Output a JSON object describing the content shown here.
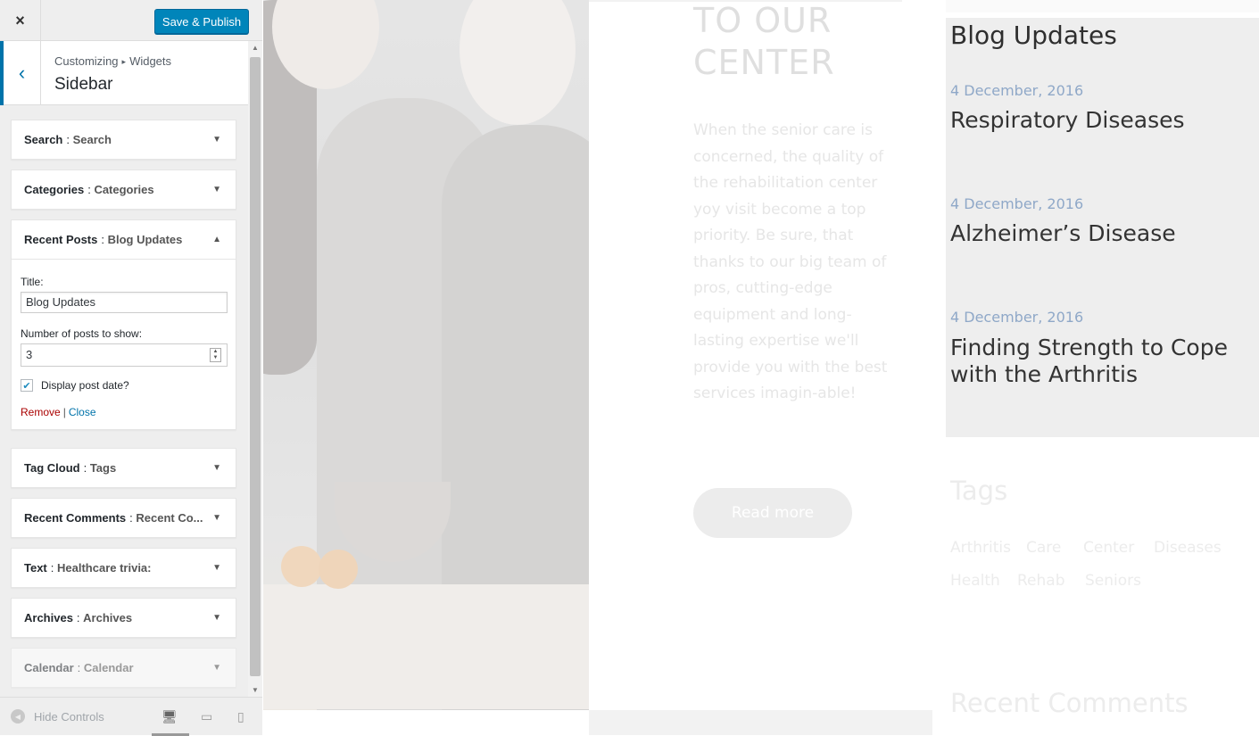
{
  "customizer": {
    "close_icon": "×",
    "save_label": "Save & Publish",
    "back_icon": "‹",
    "breadcrumb": {
      "root": "Customizing",
      "separator": "▸",
      "parent": "Widgets"
    },
    "section_title": "Sidebar",
    "widgets": [
      {
        "type": "Search",
        "instance": "Search",
        "toggle": "▼"
      },
      {
        "type": "Categories",
        "instance": "Categories",
        "toggle": "▼"
      },
      {
        "type": "Recent Posts",
        "instance": "Blog Updates",
        "toggle": "▲",
        "form": {
          "title_label": "Title:",
          "title_value": "Blog Updates",
          "number_label": "Number of posts to show:",
          "number_value": "3",
          "display_date_label": "Display post date?",
          "display_date_checked": true,
          "remove_label": "Remove",
          "separator": "|",
          "close_label": "Close"
        }
      },
      {
        "type": "Tag Cloud",
        "instance": "Tags",
        "toggle": "▼"
      },
      {
        "type": "Recent Comments",
        "instance": "Recent Co...",
        "toggle": "▼"
      },
      {
        "type": "Text",
        "instance": "Healthcare trivia:",
        "toggle": "▼"
      },
      {
        "type": "Archives",
        "instance": "Archives",
        "toggle": "▼"
      },
      {
        "type": "Calendar",
        "instance": "Calendar",
        "toggle": "▼"
      }
    ],
    "footer": {
      "hide_controls_label": "Hide Controls",
      "devices": [
        "desktop-icon",
        "tablet-icon",
        "mobile-icon"
      ]
    }
  },
  "preview": {
    "welcome_title_lines": [
      "TO OUR",
      "CENTER"
    ],
    "welcome_text": "When the senior care is concerned, the quality of the rehabilitation center yoy visit become a top priority. Be sure, that thanks to our big team of pros, cutting-edge equipment and long-lasting expertise we'll provide you with the best services imagin-able!",
    "read_more_label": "Read more",
    "blog": {
      "title": "Blog Updates",
      "posts": [
        {
          "date": "4 December, 2016",
          "title": "Respiratory Diseases"
        },
        {
          "date": "4 December, 2016",
          "title": "Alzheimer’s Disease"
        },
        {
          "date": "4 December, 2016",
          "title": "Finding Strength to Cope with the Arthritis"
        }
      ]
    },
    "tags_title": "Tags",
    "tags": [
      "Arthritis",
      "Care",
      "Center",
      "Diseases",
      "Health",
      "Rehab",
      "Seniors"
    ],
    "recent_comments_title": "Recent Comments"
  },
  "colors": {
    "primary_button": "#0085ba",
    "active_indicator": "#0073aa",
    "remove_link": "#aa0000",
    "post_date": "#8fa8c8"
  }
}
